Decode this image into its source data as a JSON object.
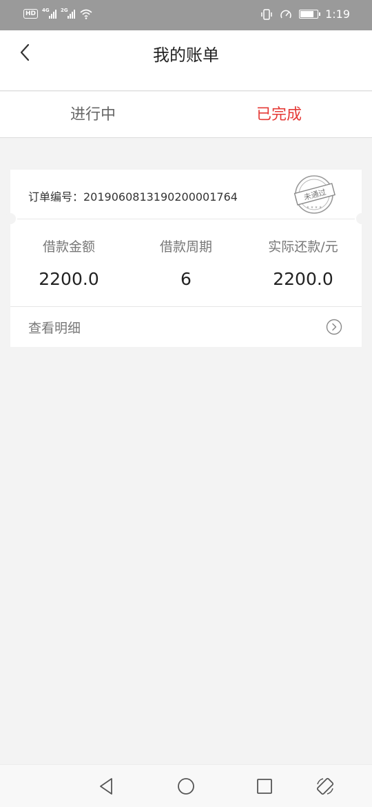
{
  "status_bar": {
    "hd": "HD",
    "net1": "4G",
    "net2": "2G",
    "time": "1:19",
    "battery_level": 0.8
  },
  "header": {
    "title": "我的账单"
  },
  "tabs": [
    {
      "label": "进行中",
      "active": false
    },
    {
      "label": "已完成",
      "active": true
    }
  ],
  "order": {
    "number_label": "订单编号：2019060813190200001764",
    "stamp_text": "未通过",
    "stats": [
      {
        "label": "借款金额",
        "value": "2200.0"
      },
      {
        "label": "借款周期",
        "value": "6"
      },
      {
        "label": "实际还款/元",
        "value": "2200.0"
      }
    ],
    "detail_label": "查看明细"
  },
  "colors": {
    "accent": "#e53935",
    "status_bar": "#9a9a9a",
    "background": "#f3f3f3"
  }
}
